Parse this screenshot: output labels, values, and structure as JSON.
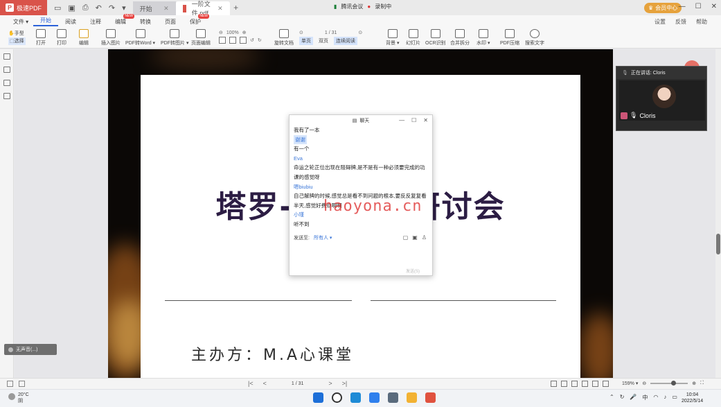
{
  "app": {
    "name": "极速PDF"
  },
  "tabs": [
    {
      "label": "开始"
    },
    {
      "label": "一阶文件.pdf"
    }
  ],
  "meeting": {
    "app_name": "腾讯会议",
    "status": "录制中",
    "member_label": "会员中心"
  },
  "menu": {
    "items": [
      {
        "label": "文件 ▾"
      },
      {
        "label": "开始"
      },
      {
        "label": "阅读"
      },
      {
        "label": "注释"
      },
      {
        "label": "编辑",
        "badge": "NEW"
      },
      {
        "label": "转换"
      },
      {
        "label": "页面"
      },
      {
        "label": "保护",
        "badge": "NEW"
      }
    ],
    "right": [
      "设置",
      "反馈",
      "帮助"
    ]
  },
  "ribbon": {
    "hand_label": "手型",
    "select_label": "选择",
    "open": "打开",
    "print": "打印",
    "edit": "编辑",
    "insert_image": "插入图片",
    "pdf_to_word": "PDF转Word ▾",
    "pdf_to_image": "PDF转图片 ▾",
    "page_edit": "页面编辑",
    "zoom": "100%",
    "rotate_doc": "旋转文档",
    "page_count": "1 / 31",
    "single_page": "单页",
    "double_page": "双页",
    "continuous": "连续阅读",
    "background": "背景 ▾",
    "slideshow": "幻灯片",
    "ocr": "OCR识别",
    "merge_split": "合并拆分",
    "watermark": "水印 ▾",
    "compress": "PDF压缩",
    "search": "搜索文字"
  },
  "document": {
    "title_left": "塔罗-",
    "title_right": "研讨会",
    "host": "主办方：M.A心课堂"
  },
  "chat": {
    "title": "聊天",
    "messages": [
      {
        "type": "text",
        "text": "我有了一本"
      },
      {
        "type": "name",
        "text": "谢谢",
        "highlight": true
      },
      {
        "type": "text",
        "text": "有一个"
      },
      {
        "type": "name",
        "text": "Eva"
      },
      {
        "type": "text",
        "text": "命运之轮正位出现在阻碍牌,是不是有一种必须要完成的功"
      },
      {
        "type": "text",
        "text": "课的感觉呀"
      },
      {
        "type": "name",
        "text": "嗯biubiu"
      },
      {
        "type": "text",
        "text": "自己解牌的时候,感觉总是看不到问题的根本,要反反复复看"
      },
      {
        "type": "text",
        "text": "半天,感觉好费劲啊啊"
      },
      {
        "type": "name",
        "text": "小瑾"
      },
      {
        "type": "text",
        "text": "听不到"
      }
    ],
    "send_to_label": "发送至:",
    "send_to_value": "所有人 ▾",
    "submit": "发送(S)"
  },
  "watermark_text": "haoyona.cn",
  "video": {
    "speaking_label": "正在讲话: Cloris",
    "participant": "Cloris"
  },
  "overlay_pill": "无声音(...)",
  "statusbar": {
    "page": "1 / 31",
    "zoom": "159% ▾"
  },
  "taskbar": {
    "temp": "20°C",
    "weather": "阴",
    "ime": "中",
    "time": "10:04",
    "date": "2022/5/14"
  }
}
